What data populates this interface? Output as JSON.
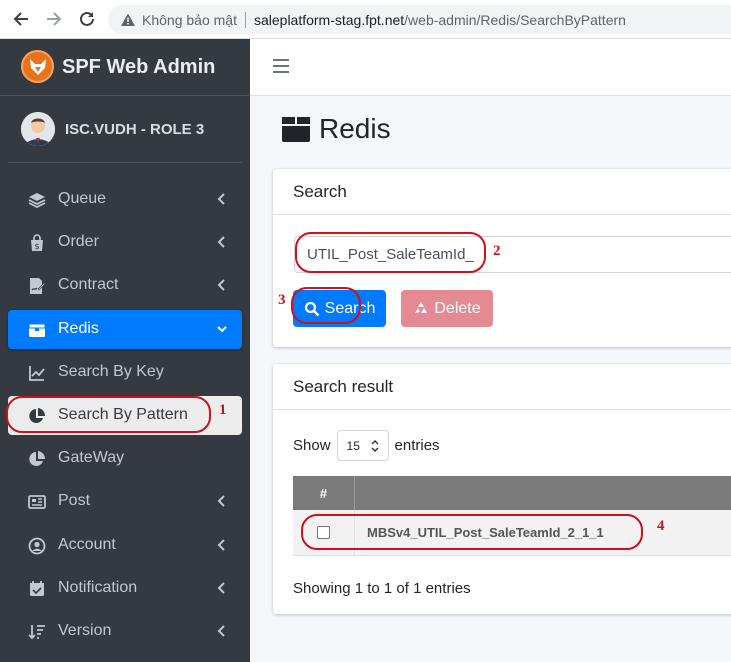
{
  "browser": {
    "insecure_label": "Không bảo mật",
    "url_host": "saleplatform-stag.fpt.net",
    "url_path": "/web-admin/Redis/SearchByPattern"
  },
  "sidebar": {
    "brand": "SPF Web Admin",
    "user": "ISC.VUDH - ROLE 3",
    "items": [
      {
        "label": "Queue",
        "icon": "layers-icon"
      },
      {
        "label": "Order",
        "icon": "shopping-bag-icon"
      },
      {
        "label": "Contract",
        "icon": "file-signature-icon"
      },
      {
        "label": "Redis",
        "icon": "box-icon"
      },
      {
        "label": "Search By Key",
        "icon": "line-chart-icon"
      },
      {
        "label": "Search By Pattern",
        "icon": "pie-chart-icon"
      },
      {
        "label": "GateWay",
        "icon": "pie-chart-icon"
      },
      {
        "label": "Post",
        "icon": "newspaper-icon"
      },
      {
        "label": "Account",
        "icon": "user-circle-icon"
      },
      {
        "label": "Notification",
        "icon": "calendar-check-icon"
      },
      {
        "label": "Version",
        "icon": "sort-amount-icon"
      }
    ]
  },
  "page": {
    "title": "Redis",
    "search_card_title": "Search",
    "search_value": "UTIL_Post_SaleTeamId_",
    "search_button": "Search",
    "delete_button": "Delete",
    "result_card_title": "Search result",
    "show_label": "Show",
    "entries_value": "15",
    "entries_label": "entries",
    "table_header_num": "#",
    "rows": [
      {
        "key": "MBSv4_UTIL_Post_SaleTeamId_2_1_1"
      }
    ],
    "showing_text": "Showing 1 to 1 of 1 entries"
  },
  "annotations": [
    "1",
    "2",
    "3",
    "4"
  ],
  "colors": {
    "sidebar_bg": "#343a40",
    "primary": "#007bff",
    "danger_light": "#e58a92",
    "annotation_red": "#d0101a"
  }
}
